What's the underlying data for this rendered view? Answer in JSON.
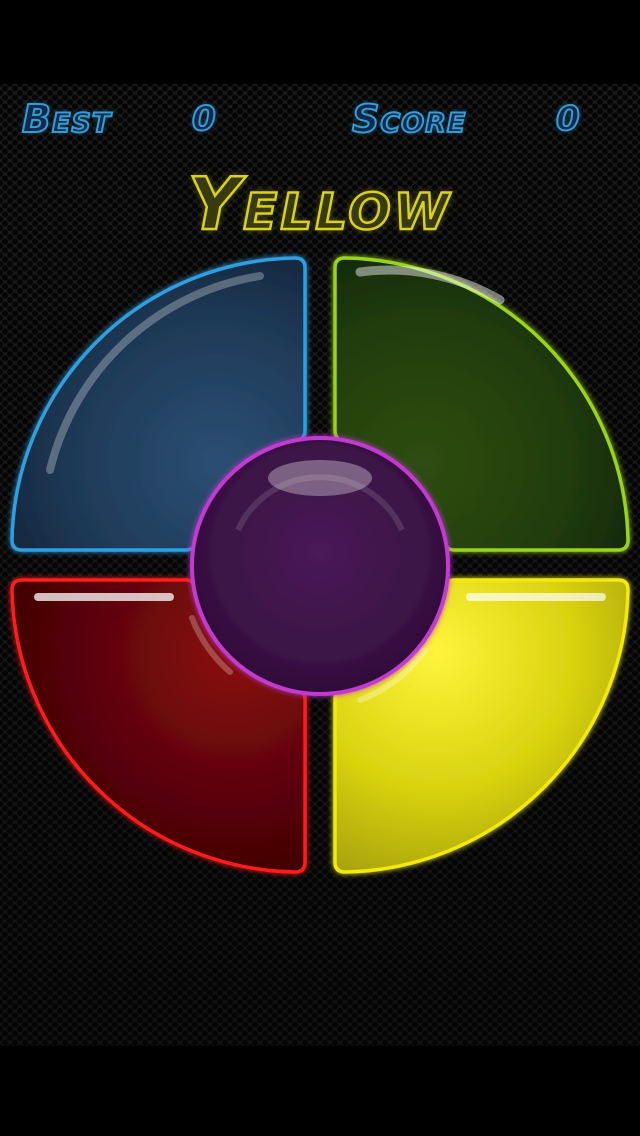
{
  "hud": {
    "best_label": "Best",
    "best_value": "0",
    "score_label": "Score",
    "score_value": "0"
  },
  "prompt": {
    "color_name": "Yellow"
  },
  "pads": {
    "blue": {
      "color": "#2f9fe0",
      "fill": "#1e3550"
    },
    "green": {
      "color": "#9ad31a",
      "fill": "#21380c"
    },
    "red": {
      "color": "#ff1a1a",
      "fill": "#5a0508"
    },
    "yellow": {
      "color": "#f2ea10",
      "fill": "#cfc90c"
    },
    "center": {
      "color": "#c13ad0",
      "fill": "#3a1245"
    }
  }
}
